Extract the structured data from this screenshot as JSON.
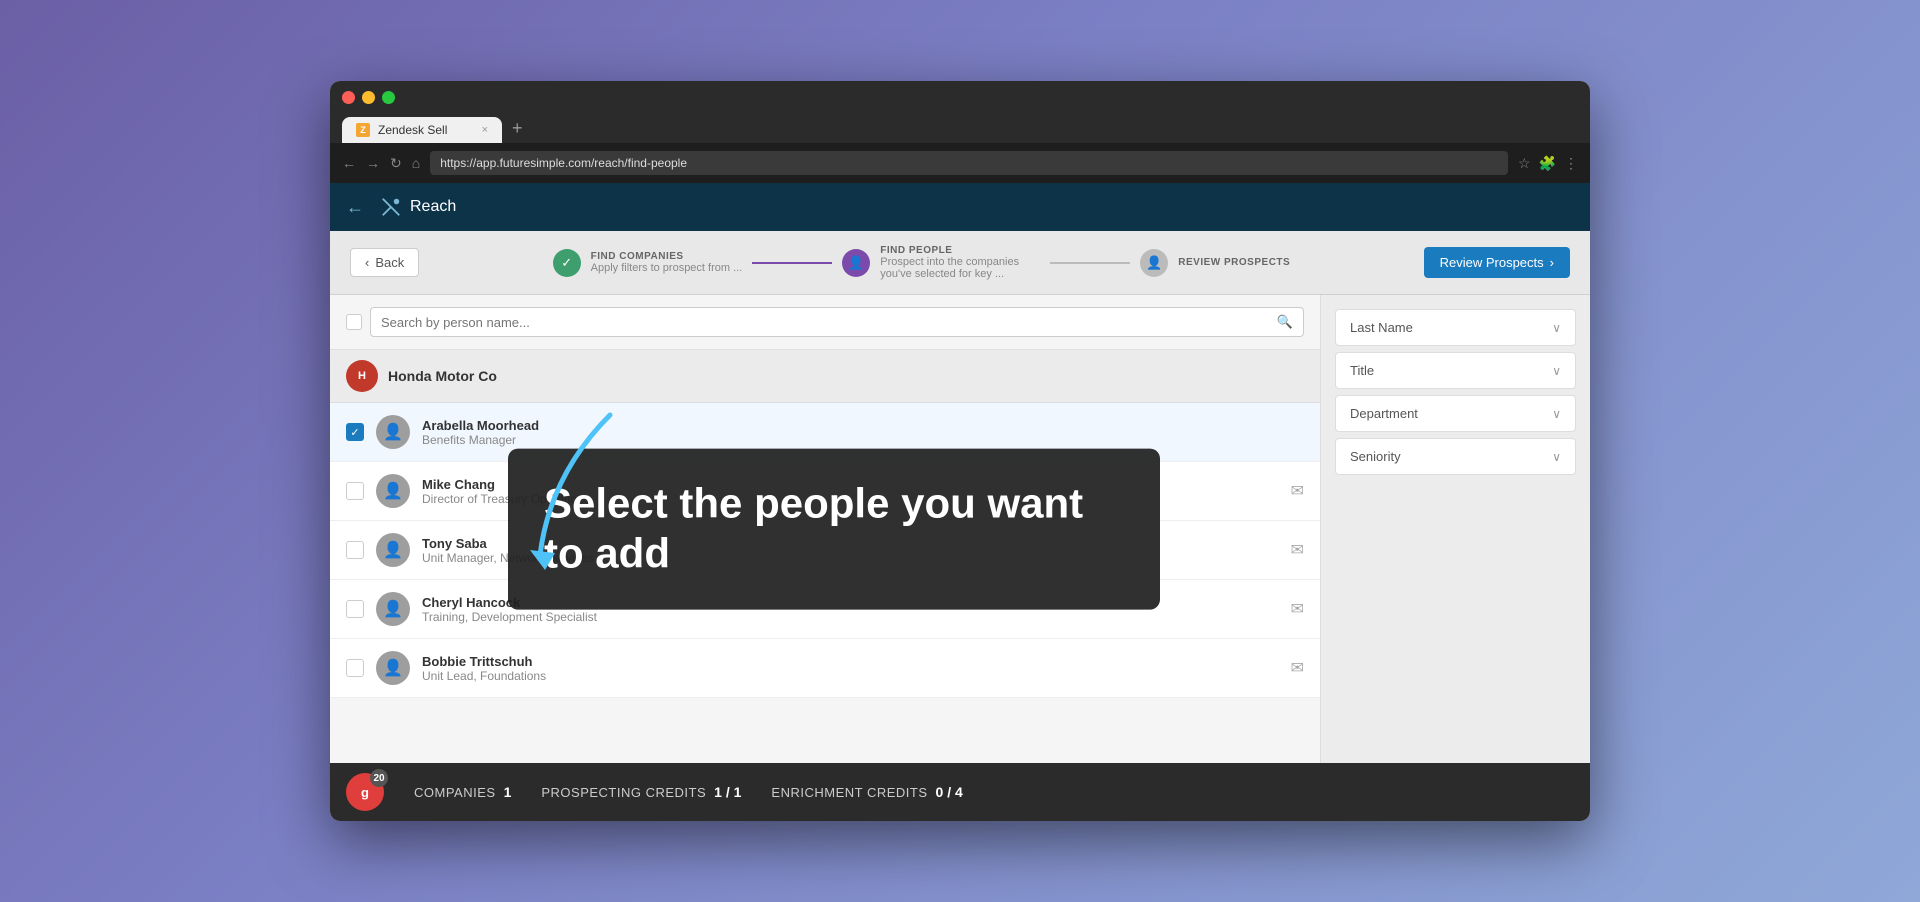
{
  "browser": {
    "tab_title": "Zendesk Sell",
    "tab_url": "https://app.futuresimple.com/reach/find-people",
    "new_tab_label": "+"
  },
  "header": {
    "app_name": "Reach",
    "back_label": "←"
  },
  "wizard": {
    "back_button_label": "Back",
    "steps": [
      {
        "id": "find-companies",
        "label": "FIND COMPANIES",
        "description": "Apply filters to prospect from ...",
        "state": "completed"
      },
      {
        "id": "find-people",
        "label": "FIND PEOPLE",
        "description": "Prospect into the companies you've selected for key ...",
        "state": "active"
      },
      {
        "id": "review-prospects",
        "label": "REVIEW PROSPECTS",
        "description": "",
        "state": "inactive"
      }
    ],
    "review_button_label": "Review Prospects"
  },
  "search": {
    "placeholder": "Search by person name..."
  },
  "company": {
    "name": "Honda Motor Co",
    "initials": "H"
  },
  "people": [
    {
      "name": "Arabella Moorhead",
      "title": "Benefits Manager",
      "selected": true,
      "has_email": false
    },
    {
      "name": "Mike Chang",
      "title": "Director of Treasury Operations",
      "selected": false,
      "has_email": true
    },
    {
      "name": "Tony Saba",
      "title": "Unit Manager, Network Services",
      "selected": false,
      "has_email": true
    },
    {
      "name": "Cheryl Hancock",
      "title": "Training, Development Specialist",
      "selected": false,
      "has_email": true
    },
    {
      "name": "Bobbie Trittschuh",
      "title": "Unit Lead, Foundations",
      "selected": false,
      "has_email": true
    }
  ],
  "filters": [
    {
      "label": "Last Name"
    },
    {
      "label": "Title"
    },
    {
      "label": "Department"
    },
    {
      "label": "Seniority"
    }
  ],
  "tooltip": {
    "text": "Select the people you want to add"
  },
  "summary": {
    "badge_letter": "g",
    "badge_count": "20",
    "companies_label": "COMPANIES",
    "companies_value": "1",
    "prospecting_credits_label": "PROSPECTING CREDITS",
    "prospecting_credits_value": "1 / 1",
    "enrichment_credits_label": "ENRICHMENT CREDITS",
    "enrichment_credits_value": "0 / 4"
  }
}
